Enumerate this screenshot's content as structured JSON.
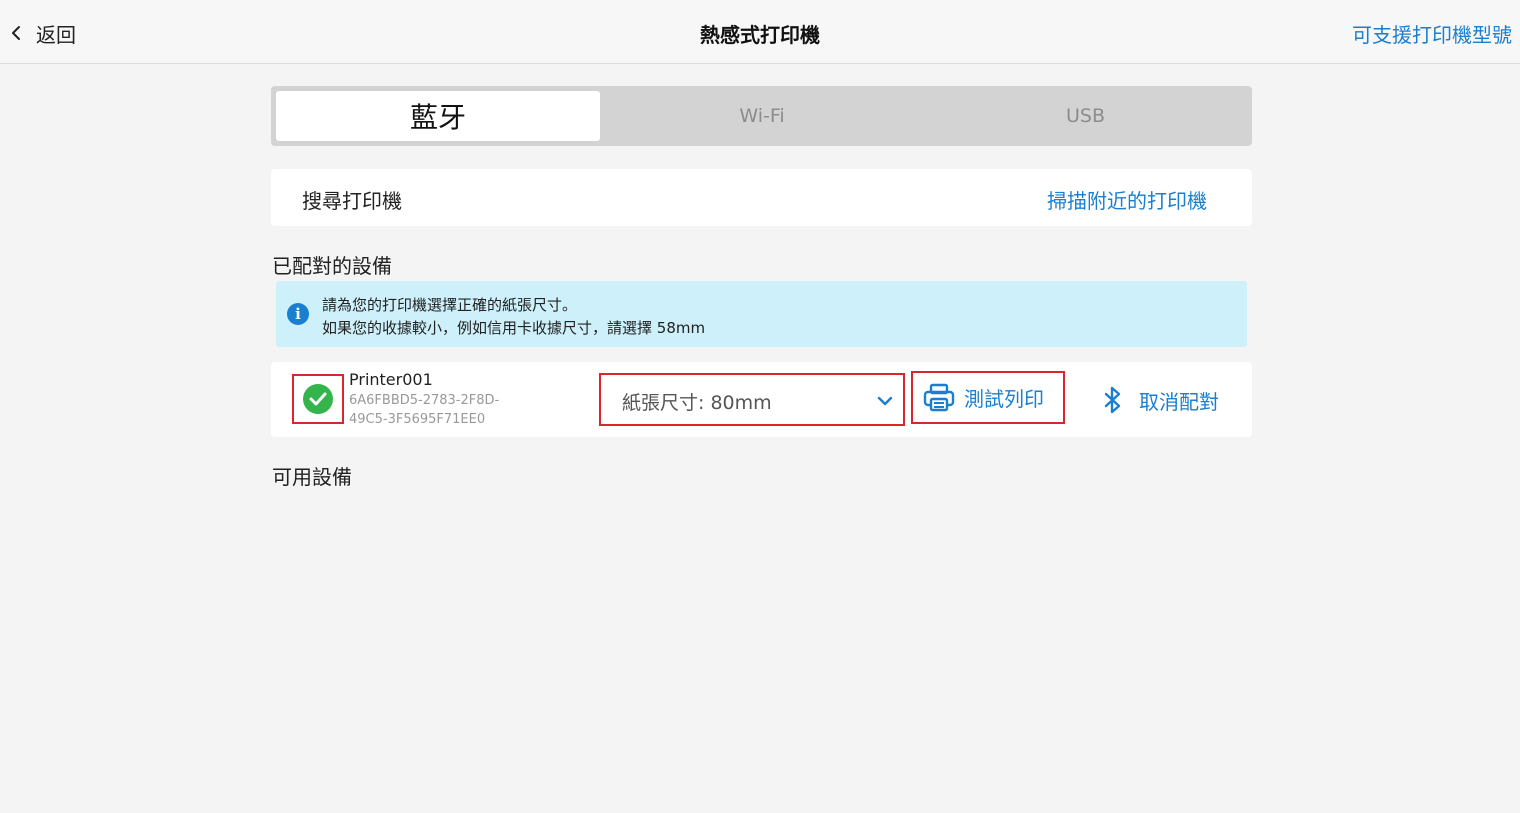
{
  "header": {
    "back_label": "返回",
    "title": "熱感式打印機",
    "supported_models_label": "可支援打印機型號"
  },
  "tabs": [
    {
      "label": "藍牙",
      "active": true
    },
    {
      "label": "Wi-Fi",
      "active": false
    },
    {
      "label": "USB",
      "active": false
    }
  ],
  "search": {
    "label": "搜尋打印機",
    "scan_label": "掃描附近的打印機"
  },
  "paired_section": {
    "title": "已配對的設備",
    "info_lines": [
      "請為您的打印機選擇正確的紙張尺寸。",
      "如果您的收據較小，例如信用卡收據尺寸，請選擇 58mm"
    ],
    "device": {
      "name": "Printer001",
      "id_line1": "6A6FBBD5-2783-2F8D-",
      "id_line2": "49C5-3F5695F71EE0",
      "paper_size_label": "紙張尺寸: 80mm",
      "test_print_label": "測試列印",
      "unpair_label": "取消配對"
    }
  },
  "available_section": {
    "title": "可用設備"
  },
  "colors": {
    "accent": "#1a7fd1",
    "success": "#34b54b",
    "highlight": "#d9262c",
    "info_bg": "#cdf0fb"
  },
  "icons": {
    "back": "chevron-left-icon",
    "info": "info-icon",
    "check": "check-circle-icon",
    "dropdown": "chevron-down-icon",
    "printer": "printer-icon",
    "bluetooth": "bluetooth-icon"
  }
}
